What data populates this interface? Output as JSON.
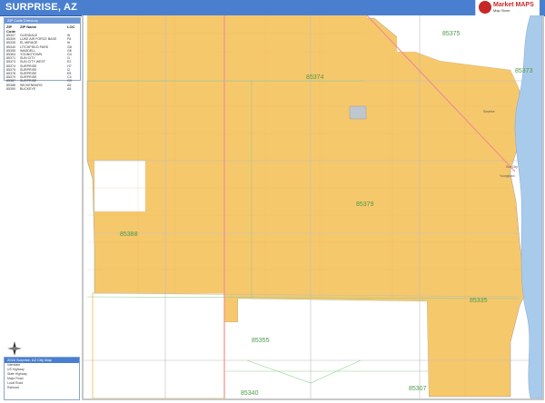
{
  "header": {
    "title": "SURPRISE, AZ",
    "brand_name": "Market MAPS",
    "brand_sub": "Map Store"
  },
  "zip_panel": {
    "heading": "ZIP Code Directory",
    "columns": {
      "code": "ZIP Code",
      "name": "ZIP Name",
      "loc": "LOC"
    },
    "rows": [
      {
        "code": "85307",
        "name": "GLENDALE",
        "loc": "I6"
      },
      {
        "code": "85309",
        "name": "LUKE AIR FORCE BASE",
        "loc": "F8"
      },
      {
        "code": "85335",
        "name": "EL MIRAGE",
        "loc": "I6"
      },
      {
        "code": "85340",
        "name": "LITCHFIELD PARK",
        "loc": "G8"
      },
      {
        "code": "85355",
        "name": "WADDELL",
        "loc": "G6"
      },
      {
        "code": "85363",
        "name": "YOUNGTOWN",
        "loc": "G3"
      },
      {
        "code": "85371",
        "name": "SUN CITY",
        "loc": "I1"
      },
      {
        "code": "85373",
        "name": "SUN CITY WEST",
        "loc": "E2"
      },
      {
        "code": "85374",
        "name": "SURPRISE",
        "loc": "H7"
      },
      {
        "code": "85375",
        "name": "SURPRISE",
        "loc": "I2"
      },
      {
        "code": "85378",
        "name": "SURPRISE",
        "loc": "E5"
      },
      {
        "code": "85379",
        "name": "SURPRISE",
        "loc": "C4"
      },
      {
        "code": "85387",
        "name": "SURPRISE",
        "loc": "G3"
      },
      {
        "code": "85388",
        "name": "WICKENBURG",
        "loc": "A5"
      },
      {
        "code": "85390",
        "name": "BUCKEYE",
        "loc": "A5"
      }
    ]
  },
  "map": {
    "zip_labels": [
      {
        "id": "85375",
        "text": "85375"
      },
      {
        "id": "85374",
        "text": "85374"
      },
      {
        "id": "85379",
        "text": "85379"
      },
      {
        "id": "85388",
        "text": "85388"
      },
      {
        "id": "85335",
        "text": "85335"
      },
      {
        "id": "85355",
        "text": "85355"
      },
      {
        "id": "85307",
        "text": "85307"
      },
      {
        "id": "85340",
        "text": "85340"
      },
      {
        "id": "85373",
        "text": "85373"
      }
    ],
    "town_labels": [
      "Surprise",
      "Sun City",
      "Youngtown"
    ],
    "colors": {
      "zone": "#f6c86c",
      "water": "#a9cbeb",
      "road": "#ef9090",
      "zip_text": "#4a9a4a"
    }
  },
  "legend": {
    "heading": "2016 Surprise, AZ City Map",
    "items": [
      "Interstate",
      "US Highway",
      "State Highway",
      "Major Road",
      "Local Road",
      "Railroad"
    ]
  },
  "compass": {
    "icon": "north-arrow-icon"
  }
}
